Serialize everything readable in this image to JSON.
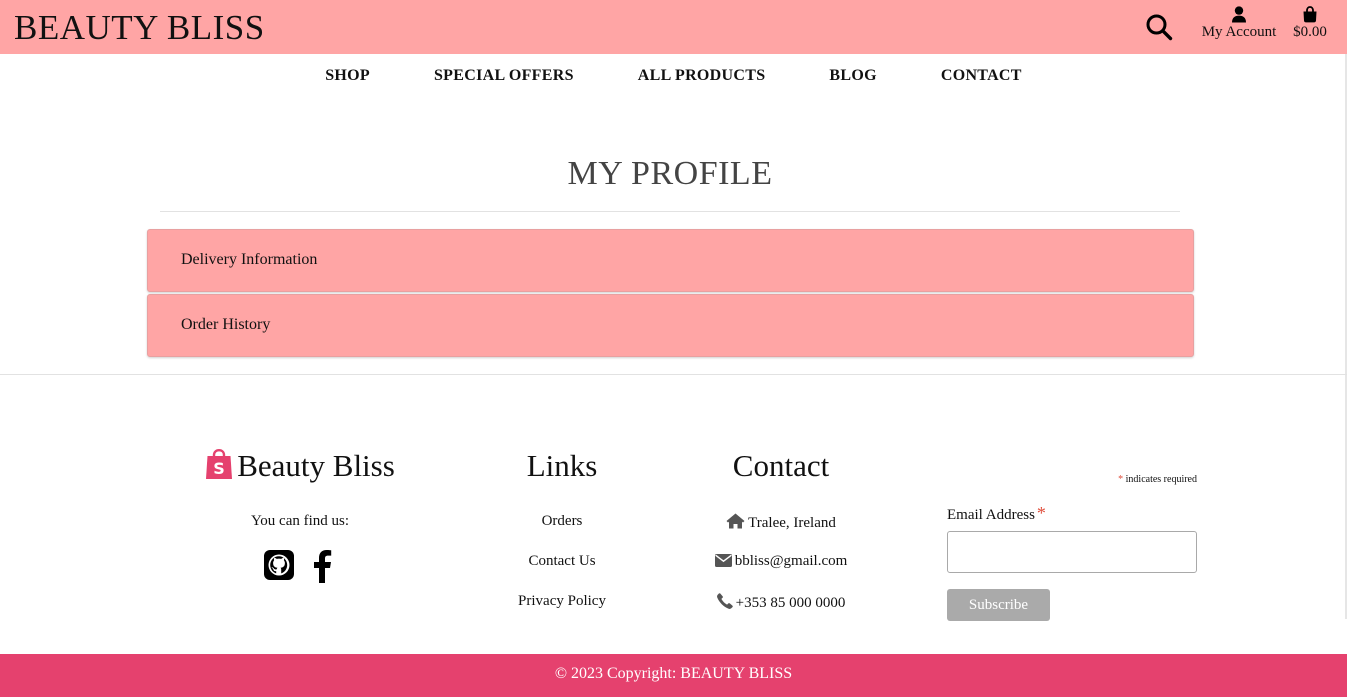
{
  "colors": {
    "header_bg": "#ffa5a5",
    "accent": "#e5416e",
    "panel_bg": "#ffa5a5",
    "required_star": "#e0503e",
    "subscribe_bg": "#aaaaaa"
  },
  "header": {
    "brand": "BEAUTY BLISS",
    "search_icon": "search-icon",
    "account_label": "My Account",
    "bag_total": "$0.00"
  },
  "nav": {
    "items": [
      {
        "label": "SHOP"
      },
      {
        "label": "SPECIAL OFFERS"
      },
      {
        "label": "ALL PRODUCTS"
      },
      {
        "label": "BLOG"
      },
      {
        "label": "CONTACT"
      }
    ]
  },
  "profile": {
    "title": "MY PROFILE",
    "panels": [
      {
        "label": "Delivery Information"
      },
      {
        "label": "Order History"
      }
    ]
  },
  "footer": {
    "brand": "Beauty Bliss",
    "find_us": "You can find us:",
    "social": [
      "github-icon",
      "facebook-icon"
    ],
    "links_title": "Links",
    "links": [
      {
        "label": "Orders"
      },
      {
        "label": "Contact Us"
      },
      {
        "label": "Privacy Policy"
      }
    ],
    "contact_title": "Contact",
    "contact": {
      "address": "Tralee, Ireland",
      "email": "bbliss@gmail.com",
      "phone": "+353 85 000 0000"
    },
    "newsletter": {
      "required_star": "*",
      "required_note": "indicates required",
      "email_label": "Email Address",
      "email_value": "",
      "subscribe_label": "Subscribe"
    },
    "copyright": "© 2023 Copyright: BEAUTY BLISS"
  }
}
